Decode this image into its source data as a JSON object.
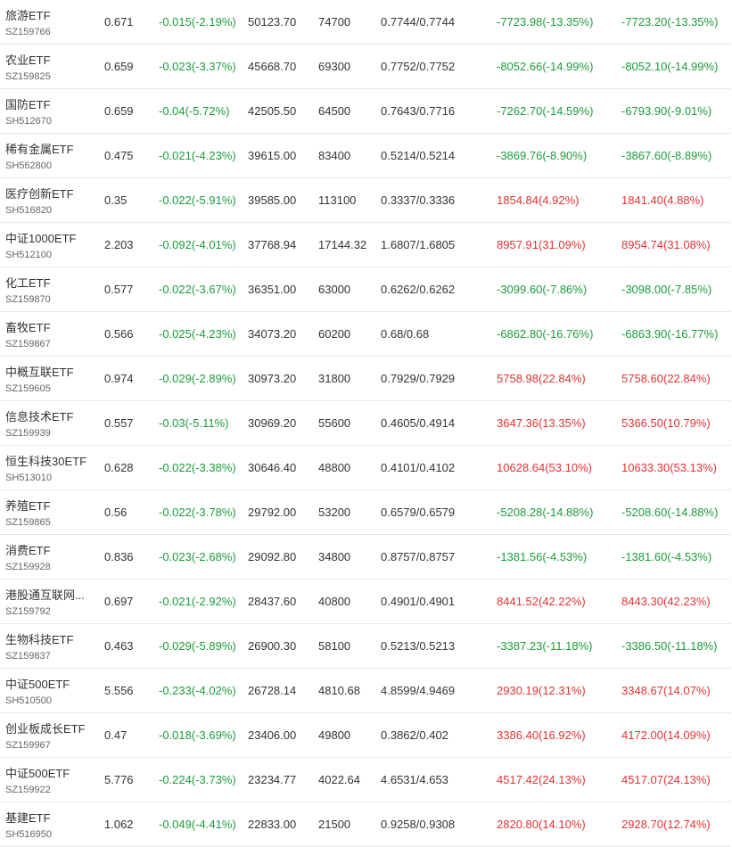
{
  "colors": {
    "up": "#e33333",
    "down": "#1b9c3a",
    "text": "#333333",
    "subtext": "#666666",
    "divider": "#e8e8e8"
  },
  "rows": [
    {
      "name": "旅游ETF",
      "code": "SZ159766",
      "price": "0.671",
      "change": "-0.015(-2.19%)",
      "value": "50123.70",
      "shares": "74700",
      "cost": "0.7744/0.7744",
      "float_pl": "-7723.98(-13.35%)",
      "total_pl": "-7723.20(-13.35%)",
      "dir": "down"
    },
    {
      "name": "农业ETF",
      "code": "SZ159825",
      "price": "0.659",
      "change": "-0.023(-3.37%)",
      "value": "45668.70",
      "shares": "69300",
      "cost": "0.7752/0.7752",
      "float_pl": "-8052.66(-14.99%)",
      "total_pl": "-8052.10(-14.99%)",
      "dir": "down"
    },
    {
      "name": "国防ETF",
      "code": "SH512670",
      "price": "0.659",
      "change": "-0.04(-5.72%)",
      "value": "42505.50",
      "shares": "64500",
      "cost": "0.7643/0.7716",
      "float_pl": "-7262.70(-14.59%)",
      "total_pl": "-6793.90(-9.01%)",
      "dir": "down"
    },
    {
      "name": "稀有金属ETF",
      "code": "SH562800",
      "price": "0.475",
      "change": "-0.021(-4.23%)",
      "value": "39615.00",
      "shares": "83400",
      "cost": "0.5214/0.5214",
      "float_pl": "-3869.76(-8.90%)",
      "total_pl": "-3867.60(-8.89%)",
      "dir": "down"
    },
    {
      "name": "医疗创新ETF",
      "code": "SH516820",
      "price": "0.35",
      "change": "-0.022(-5.91%)",
      "value": "39585.00",
      "shares": "113100",
      "cost": "0.3337/0.3336",
      "float_pl": "1854.84(4.92%)",
      "total_pl": "1841.40(4.88%)",
      "dir": "up"
    },
    {
      "name": "中证1000ETF",
      "code": "SH512100",
      "price": "2.203",
      "change": "-0.092(-4.01%)",
      "value": "37768.94",
      "shares": "17144.32",
      "cost": "1.6807/1.6805",
      "float_pl": "8957.91(31.09%)",
      "total_pl": "8954.74(31.08%)",
      "dir": "up"
    },
    {
      "name": "化工ETF",
      "code": "SZ159870",
      "price": "0.577",
      "change": "-0.022(-3.67%)",
      "value": "36351.00",
      "shares": "63000",
      "cost": "0.6262/0.6262",
      "float_pl": "-3099.60(-7.86%)",
      "total_pl": "-3098.00(-7.85%)",
      "dir": "down"
    },
    {
      "name": "畜牧ETF",
      "code": "SZ159867",
      "price": "0.566",
      "change": "-0.025(-4.23%)",
      "value": "34073.20",
      "shares": "60200",
      "cost": "0.68/0.68",
      "float_pl": "-6862.80(-16.76%)",
      "total_pl": "-6863.90(-16.77%)",
      "dir": "down"
    },
    {
      "name": "中概互联ETF",
      "code": "SZ159605",
      "price": "0.974",
      "change": "-0.029(-2.89%)",
      "value": "30973.20",
      "shares": "31800",
      "cost": "0.7929/0.7929",
      "float_pl": "5758.98(22.84%)",
      "total_pl": "5758.60(22.84%)",
      "dir": "up"
    },
    {
      "name": "信息技术ETF",
      "code": "SZ159939",
      "price": "0.557",
      "change": "-0.03(-5.11%)",
      "value": "30969.20",
      "shares": "55600",
      "cost": "0.4605/0.4914",
      "float_pl": "3647.36(13.35%)",
      "total_pl": "5366.50(10.79%)",
      "dir": "up"
    },
    {
      "name": "恒生科技30ETF",
      "code": "SH513010",
      "price": "0.628",
      "change": "-0.022(-3.38%)",
      "value": "30646.40",
      "shares": "48800",
      "cost": "0.4101/0.4102",
      "float_pl": "10628.64(53.10%)",
      "total_pl": "10633.30(53.13%)",
      "dir": "up"
    },
    {
      "name": "养殖ETF",
      "code": "SZ159865",
      "price": "0.56",
      "change": "-0.022(-3.78%)",
      "value": "29792.00",
      "shares": "53200",
      "cost": "0.6579/0.6579",
      "float_pl": "-5208.28(-14.88%)",
      "total_pl": "-5208.60(-14.88%)",
      "dir": "down"
    },
    {
      "name": "消费ETF",
      "code": "SZ159928",
      "price": "0.836",
      "change": "-0.023(-2.68%)",
      "value": "29092.80",
      "shares": "34800",
      "cost": "0.8757/0.8757",
      "float_pl": "-1381.56(-4.53%)",
      "total_pl": "-1381.60(-4.53%)",
      "dir": "down"
    },
    {
      "name": "港股通互联网...",
      "code": "SZ159792",
      "price": "0.697",
      "change": "-0.021(-2.92%)",
      "value": "28437.60",
      "shares": "40800",
      "cost": "0.4901/0.4901",
      "float_pl": "8441.52(42.22%)",
      "total_pl": "8443.30(42.23%)",
      "dir": "up"
    },
    {
      "name": "生物科技ETF",
      "code": "SZ159837",
      "price": "0.463",
      "change": "-0.029(-5.89%)",
      "value": "26900.30",
      "shares": "58100",
      "cost": "0.5213/0.5213",
      "float_pl": "-3387.23(-11.18%)",
      "total_pl": "-3386.50(-11.18%)",
      "dir": "down"
    },
    {
      "name": "中证500ETF",
      "code": "SH510500",
      "price": "5.556",
      "change": "-0.233(-4.02%)",
      "value": "26728.14",
      "shares": "4810.68",
      "cost": "4.8599/4.9469",
      "float_pl": "2930.19(12.31%)",
      "total_pl": "3348.67(14.07%)",
      "dir": "up"
    },
    {
      "name": "创业板成长ETF",
      "code": "SZ159967",
      "price": "0.47",
      "change": "-0.018(-3.69%)",
      "value": "23406.00",
      "shares": "49800",
      "cost": "0.3862/0.402",
      "float_pl": "3386.40(16.92%)",
      "total_pl": "4172.00(14.09%)",
      "dir": "up"
    },
    {
      "name": "中证500ETF",
      "code": "SZ159922",
      "price": "5.776",
      "change": "-0.224(-3.73%)",
      "value": "23234.77",
      "shares": "4022.64",
      "cost": "4.6531/4.653",
      "float_pl": "4517.42(24.13%)",
      "total_pl": "4517.07(24.13%)",
      "dir": "up"
    },
    {
      "name": "基建ETF",
      "code": "SH516950",
      "price": "1.062",
      "change": "-0.049(-4.41%)",
      "value": "22833.00",
      "shares": "21500",
      "cost": "0.9258/0.9308",
      "float_pl": "2820.80(14.10%)",
      "total_pl": "2928.70(12.74%)",
      "dir": "up"
    }
  ]
}
